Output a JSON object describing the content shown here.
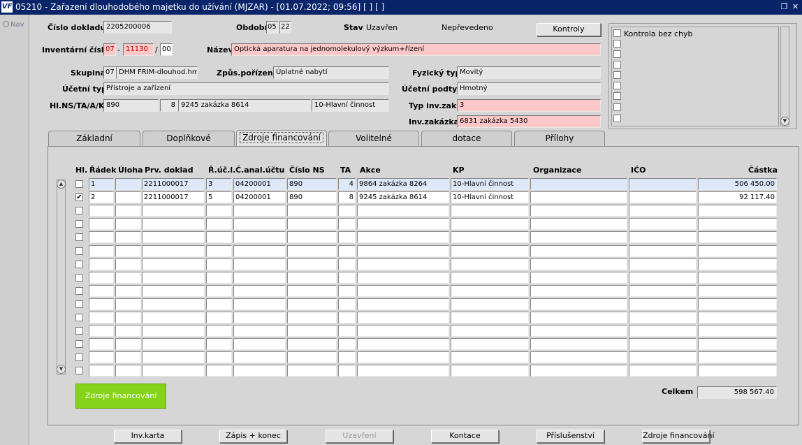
{
  "window": {
    "title": "05210 - Zařazení dlouhodobého majetku do užívání (MJZAR) - [01.07.2022; 09:56]  [ ]  [ ]",
    "logo_text": "VF",
    "restore_glyph": "❐",
    "close_glyph": "✕"
  },
  "nav": {
    "label": "Nav"
  },
  "header": {
    "cislo_dokladu_label": "Číslo dokladu",
    "cislo_dokladu": "2205200006",
    "obdobi_label": "Období",
    "obdobi_m": "05",
    "obdobi_y": "22",
    "stav_label": "Stav",
    "stav": "Uzavřen",
    "prevod": "Nepřevedeno",
    "kontroly_button": "Kontroly",
    "inv_cislo_label": "Inventární číslo",
    "inv_1": "07",
    "dash": "-",
    "inv_2": "11130",
    "slash": "/",
    "inv_3": "00",
    "nazev_label": "Název",
    "nazev": "Optická aparatura na jednomolekulový výzkum+řízení",
    "skupina_label": "Skupina",
    "skupina_code": "07",
    "skupina_name": "DHM FRIM-dlouhod.hmo",
    "zpusob_label": "Způs.pořízení",
    "zpusob": "Úplatné nabytí",
    "fyzicky_label": "Fyzický typ",
    "fyzicky": "Movitý",
    "ucetni_typ_label": "Účetní typ",
    "ucetni_typ": "Přístroje a zařízení",
    "ucetni_podtyp_label": "Účetní podtyp",
    "ucetni_podtyp": "Hmotný",
    "hlns_label": "Hl.NS/TA/A/KP",
    "hlns_ns": "890",
    "hlns_ta": "8",
    "hlns_a": "9245 zakázka 8614",
    "hlns_kp": "10-Hlavní činnost",
    "typ_inv_label": "Typ inv.zak.",
    "typ_inv": "3",
    "inv_zakazka_label": "Inv.zakázka",
    "inv_zakazka": "6831 zakázka 5430"
  },
  "checklist": {
    "item_label": "Kontrola bez chyb"
  },
  "tabs": [
    {
      "label": "Základní"
    },
    {
      "label": "Doplňkové"
    },
    {
      "label": "Zdroje financování"
    },
    {
      "label": "Volitelné"
    },
    {
      "label": "dotace"
    },
    {
      "label": "Přílohy"
    }
  ],
  "active_tab": 2,
  "table": {
    "columns": [
      "Hl.",
      "Řádek",
      "Úloha",
      "Prv. doklad",
      "Ř.úč.l.",
      "Č.anal.účtu",
      "Číslo NS",
      "TA",
      "Akce",
      "KP",
      "Organizace",
      "IČO",
      "Částka"
    ],
    "rows": [
      {
        "hl": false,
        "radek": "1",
        "uloha": "",
        "doklad": "2211000017",
        "ucl": "3",
        "anal": "04200001",
        "ns": "890",
        "ta": "4",
        "akce": "9864 zakázka 8264",
        "kp": "10-Hlavní činnost",
        "org": "",
        "ico": "",
        "castka": "506 450.00"
      },
      {
        "hl": true,
        "radek": "2",
        "uloha": "",
        "doklad": "2211000017",
        "ucl": "5",
        "anal": "04200001",
        "ns": "890",
        "ta": "8",
        "akce": "9245 zakázka 8614",
        "kp": "10-Hlavní činnost",
        "org": "",
        "ico": "",
        "castka": "92 117.40"
      }
    ],
    "check_mark": "✔"
  },
  "celkem_label": "Celkem",
  "celkem": "598 567.40",
  "green_button": "Zdroje financování",
  "bottom_buttons": [
    {
      "label": "Inv.karta",
      "enabled": true
    },
    {
      "label": "Zápis + konec",
      "enabled": true
    },
    {
      "label": "Uzavření",
      "enabled": false
    },
    {
      "label": "Kontace",
      "enabled": true
    },
    {
      "label": "Příslušenství",
      "enabled": true
    },
    {
      "label": "Zdroje financování",
      "enabled": true
    }
  ],
  "colors": {
    "titlebar": "#0a246a",
    "required": "#ffc8c8",
    "selected_row": "#dde9f9",
    "green_button": "#84d21a"
  }
}
